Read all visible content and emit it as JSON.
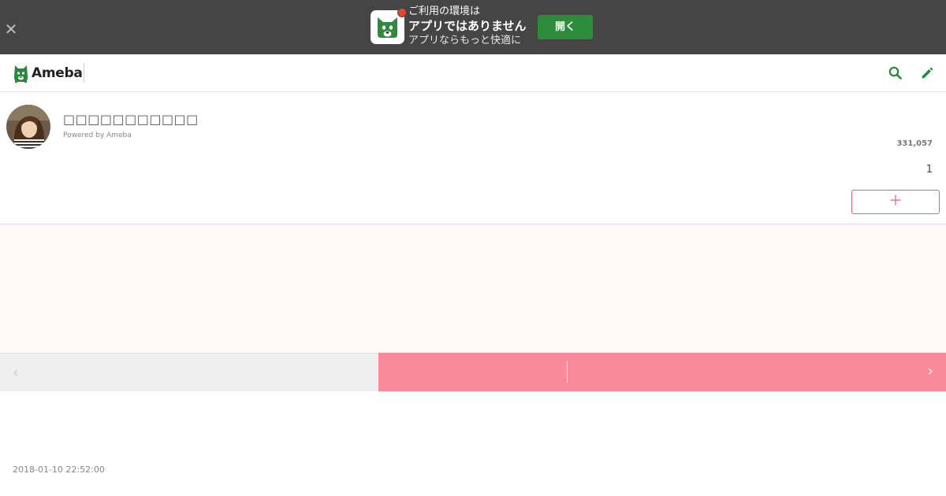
{
  "banner": {
    "close_icon": "close-icon",
    "line1": "ご利用の環境は",
    "line2": "アプリではありません",
    "line3": "アプリならもっと快適に",
    "open_label": "開く",
    "open_color": "#2d8c3c",
    "badge_color": "#e8452c"
  },
  "header": {
    "logo_text": "Ameba",
    "search_icon": "search-icon",
    "edit_icon": "pencil-icon",
    "accent": "#238b3a"
  },
  "profile": {
    "blog_title": "□□□□□□□□□□□",
    "powered_by": "Powered by Ameba",
    "follower_count": "331,057",
    "small_count": "1",
    "follow_label": "＋",
    "follow_color": "#e66078"
  },
  "pager": {
    "prev_icon": "chevron-left-icon",
    "next_icon": "chevron-right-icon",
    "active_color": "#f98a9a"
  },
  "post": {
    "date": "2018-01-10 22:52:00"
  }
}
